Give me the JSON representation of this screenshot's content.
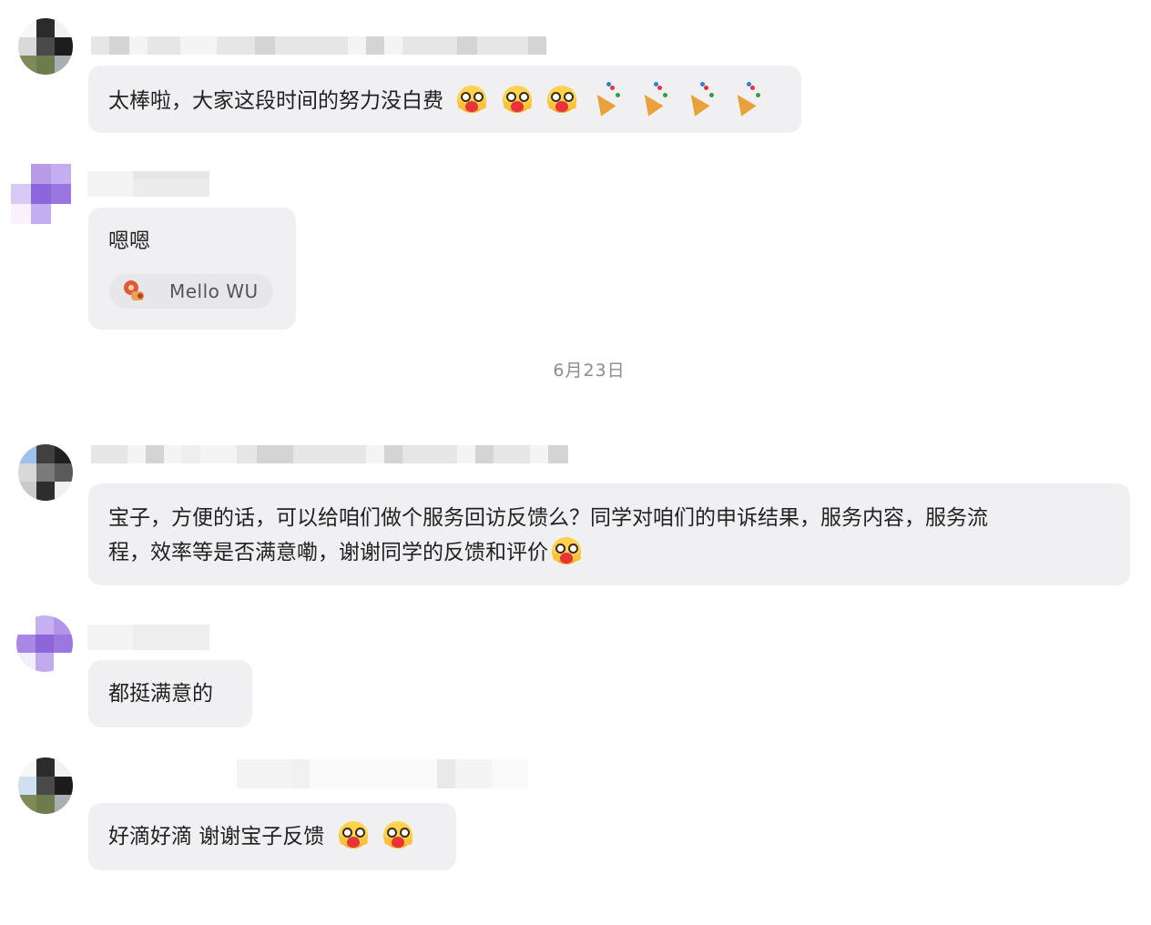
{
  "date_separator": "6月23日",
  "messages": [
    {
      "text": "太棒啦，大家这段时间的努力没白费",
      "emoji": [
        "smile-heart-emoji",
        "smile-heart-emoji",
        "smile-heart-emoji",
        "party-popper-emoji",
        "party-popper-emoji",
        "party-popper-emoji",
        "party-popper-emoji"
      ]
    },
    {
      "text": "嗯嗯",
      "reply_chip": {
        "label": "Mello WU",
        "icon": "reply-avatar-icon"
      }
    },
    {
      "text_line1": "宝子，方便的话，可以给咱们做个服务回访反馈么？同学对咱们的申诉结果，服务内容，服务流",
      "text_line2": "程，效率等是否满意嘞，谢谢同学的反馈和评价",
      "emoji": [
        "smile-heart-emoji"
      ]
    },
    {
      "text": "都挺满意的"
    },
    {
      "text": "好滴好滴 谢谢宝子反馈",
      "emoji": [
        "smile-heart-emoji",
        "smile-heart-emoji"
      ]
    }
  ],
  "colors": {
    "bubble": "#f0f0f2",
    "text": "#222222",
    "date": "#8b8b90",
    "emoji_face": "#ffd34d",
    "emoji_heart": "#e8333b"
  }
}
